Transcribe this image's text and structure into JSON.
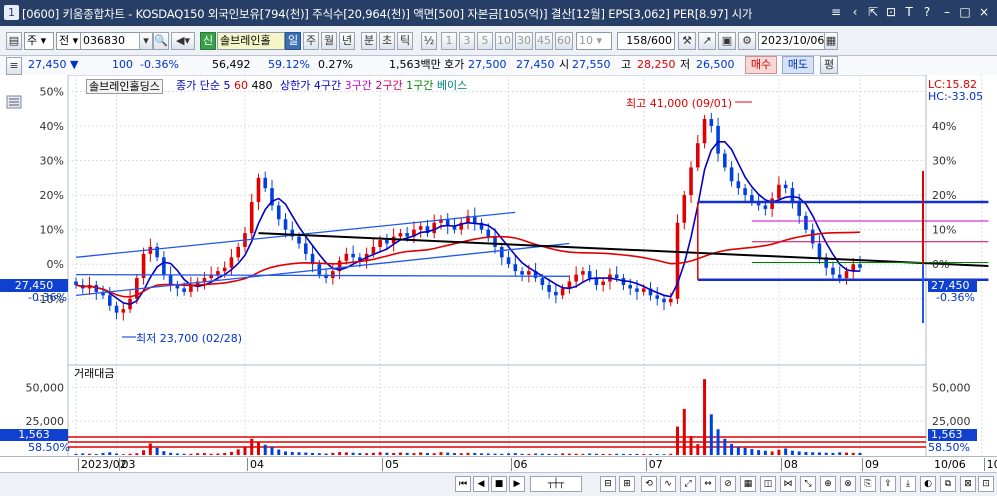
{
  "window": {
    "number": "1",
    "title": "[0600] 키움종합차트 - KOSDAQ150 외국인보유[794(천)] 주식수[20,964(천)] 액면[500] 자본금[105(억)] 결산[12월] EPS[3,062] PER[8.97] 시가",
    "buttons": [
      "≡",
      "‹",
      "⇱",
      "⊡",
      "T",
      "?",
      "–",
      "□",
      "×"
    ]
  },
  "toolbar": {
    "market": "주",
    "type": "전",
    "code": "036830",
    "badge": "신",
    "name": "솔브레인홀",
    "periods": [
      "일",
      "주",
      "월",
      "년",
      "분",
      "초",
      "틱"
    ],
    "active_period": "일",
    "fraction": "½",
    "minutes": [
      "1",
      "3",
      "5",
      "10",
      "30",
      "45",
      "60"
    ],
    "minute_select": "10",
    "count": "158/600",
    "date": "2023/10/06"
  },
  "quote": {
    "price": "27,450",
    "down_arrow": "▼",
    "change": "100",
    "change_pct": "-0.36%",
    "volume": "56,492",
    "vol_ratio": "59.12%",
    "turnover": "0.27%",
    "amount": "1,563백만",
    "hoga_label": "호가",
    "ask": "27,500",
    "bid": "27,450",
    "open_label": "시",
    "open": "27,550",
    "high_label": "고",
    "high": "28,250",
    "low_label": "저",
    "low": "26,500",
    "buy": "매수",
    "sell": "매도",
    "eval": "평"
  },
  "legend": {
    "stock": "솔브레인홀딩스",
    "ma_label": "종가 단순",
    "ma1": "5",
    "ma2": "60",
    "ma3": "480",
    "env": "상한가 4구간",
    "env3": "3구간",
    "env2": "2구간",
    "env1": "1구간",
    "base": "베이스"
  },
  "annotations": {
    "high": "최고 41,000 (09/01)",
    "low": "최저 23,700 (02/28)",
    "lc": "LC:15.82",
    "hc": "HC:-33.05"
  },
  "axis": {
    "y_ticks": [
      "50%",
      "40%",
      "30%",
      "20%",
      "10%",
      "0%",
      "-10%"
    ],
    "right_ticks": [
      "40%",
      "30%",
      "20%",
      "10%",
      "0%",
      "-10%"
    ],
    "current_left": "27,450",
    "current_left_pct": "-0.36%",
    "current_right": "27,450",
    "current_right_pct": "-0.36%",
    "x_labels": [
      "2023/02",
      "03",
      "04",
      "05",
      "06",
      "07",
      "08",
      "09",
      "10"
    ],
    "x_right": "10/06"
  },
  "volume_panel": {
    "title": "거래대금",
    "ticks": [
      "50,000",
      "25,000"
    ],
    "current": "1,563",
    "pct": "58.50%"
  },
  "colors": {
    "up": "#e00000",
    "down": "#0040e0",
    "ma5": "#0000c8",
    "ma60": "#e00000",
    "trend": "#000000"
  },
  "chart_data": {
    "type": "candlestick",
    "y_unit": "% from base",
    "ylim": [
      -17,
      53
    ],
    "x_labels": [
      "2023/02",
      "03",
      "04",
      "05",
      "06",
      "07",
      "08",
      "09",
      "10"
    ],
    "close_pct": [
      -6,
      -7,
      -6,
      -8,
      -9,
      -12,
      -14,
      -13,
      -10,
      -4,
      3,
      5,
      2,
      -3,
      -6,
      -7,
      -8,
      -6,
      -5,
      -4,
      -3,
      -2,
      -1,
      2,
      5,
      9,
      18,
      25,
      22,
      17,
      13,
      10,
      8,
      6,
      3,
      0,
      -3,
      -4,
      -2,
      1,
      3,
      2,
      1,
      3,
      5,
      7,
      6,
      8,
      9,
      8,
      10,
      11,
      9,
      12,
      13,
      11,
      10,
      12,
      14,
      12,
      10,
      8,
      5,
      2,
      0,
      -2,
      -3,
      -2,
      -4,
      -6,
      -8,
      -9,
      -7,
      -5,
      -3,
      -2,
      -4,
      -6,
      -5,
      -3,
      -4,
      -6,
      -7,
      -8,
      -7,
      -9,
      -10,
      -11,
      -10,
      12,
      20,
      28,
      35,
      42,
      40,
      32,
      28,
      24,
      22,
      20,
      18,
      17,
      16,
      19,
      23,
      22,
      18,
      14,
      10,
      6,
      2,
      -1,
      -3,
      -4,
      -2,
      0,
      -1
    ],
    "volume": [
      800,
      1200,
      900,
      700,
      1500,
      2000,
      1100,
      600,
      900,
      1300,
      3500,
      8500,
      5200,
      2800,
      1600,
      1100,
      900,
      800,
      1300,
      1400,
      900,
      1100,
      1500,
      2300,
      4100,
      6200,
      12000,
      9800,
      7600,
      6100,
      4000,
      2600,
      2200,
      2000,
      1800,
      1500,
      1300,
      1100,
      1600,
      2100,
      1900,
      1700,
      1400,
      1300,
      1600,
      2000,
      1700,
      1500,
      1800,
      1600,
      1400,
      1900,
      1500,
      1300,
      2100,
      1800,
      1400,
      1300,
      1600,
      1500,
      1200,
      1100,
      1000,
      900,
      1200,
      1400,
      900,
      800,
      1100,
      1000,
      900,
      800,
      1200,
      1000,
      900,
      800,
      1100,
      900,
      800,
      700,
      900,
      800,
      700,
      800,
      700,
      600,
      700,
      600,
      900,
      21000,
      34000,
      14000,
      8000,
      56000,
      30000,
      19000,
      12000,
      8200,
      6100,
      5200,
      4400,
      3600,
      3100,
      2600,
      3900,
      4800,
      3200,
      2600,
      2200,
      2000,
      1900,
      1700,
      1563,
      2000,
      1800,
      1600,
      1563
    ]
  }
}
